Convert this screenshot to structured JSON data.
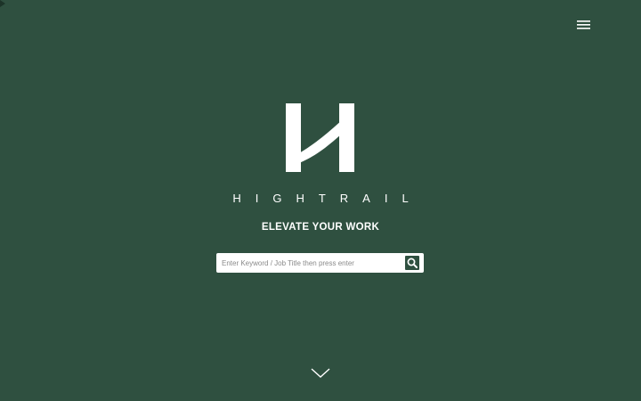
{
  "header": {
    "menu_icon": "hamburger-menu-icon"
  },
  "hero": {
    "logo_icon": "hightrail-h-logo-icon",
    "brand_name": "HIGHTRAIL",
    "tagline": "ELEVATE YOUR WORK"
  },
  "search": {
    "value": "",
    "placeholder": "Enter Keyword / Job Title then press enter",
    "button_icon": "search-icon"
  },
  "scroll": {
    "icon": "chevron-down-icon"
  },
  "colors": {
    "background": "#2f5040",
    "text": "#ffffff",
    "search_button": "#2f5040",
    "input_background": "#ffffff"
  }
}
